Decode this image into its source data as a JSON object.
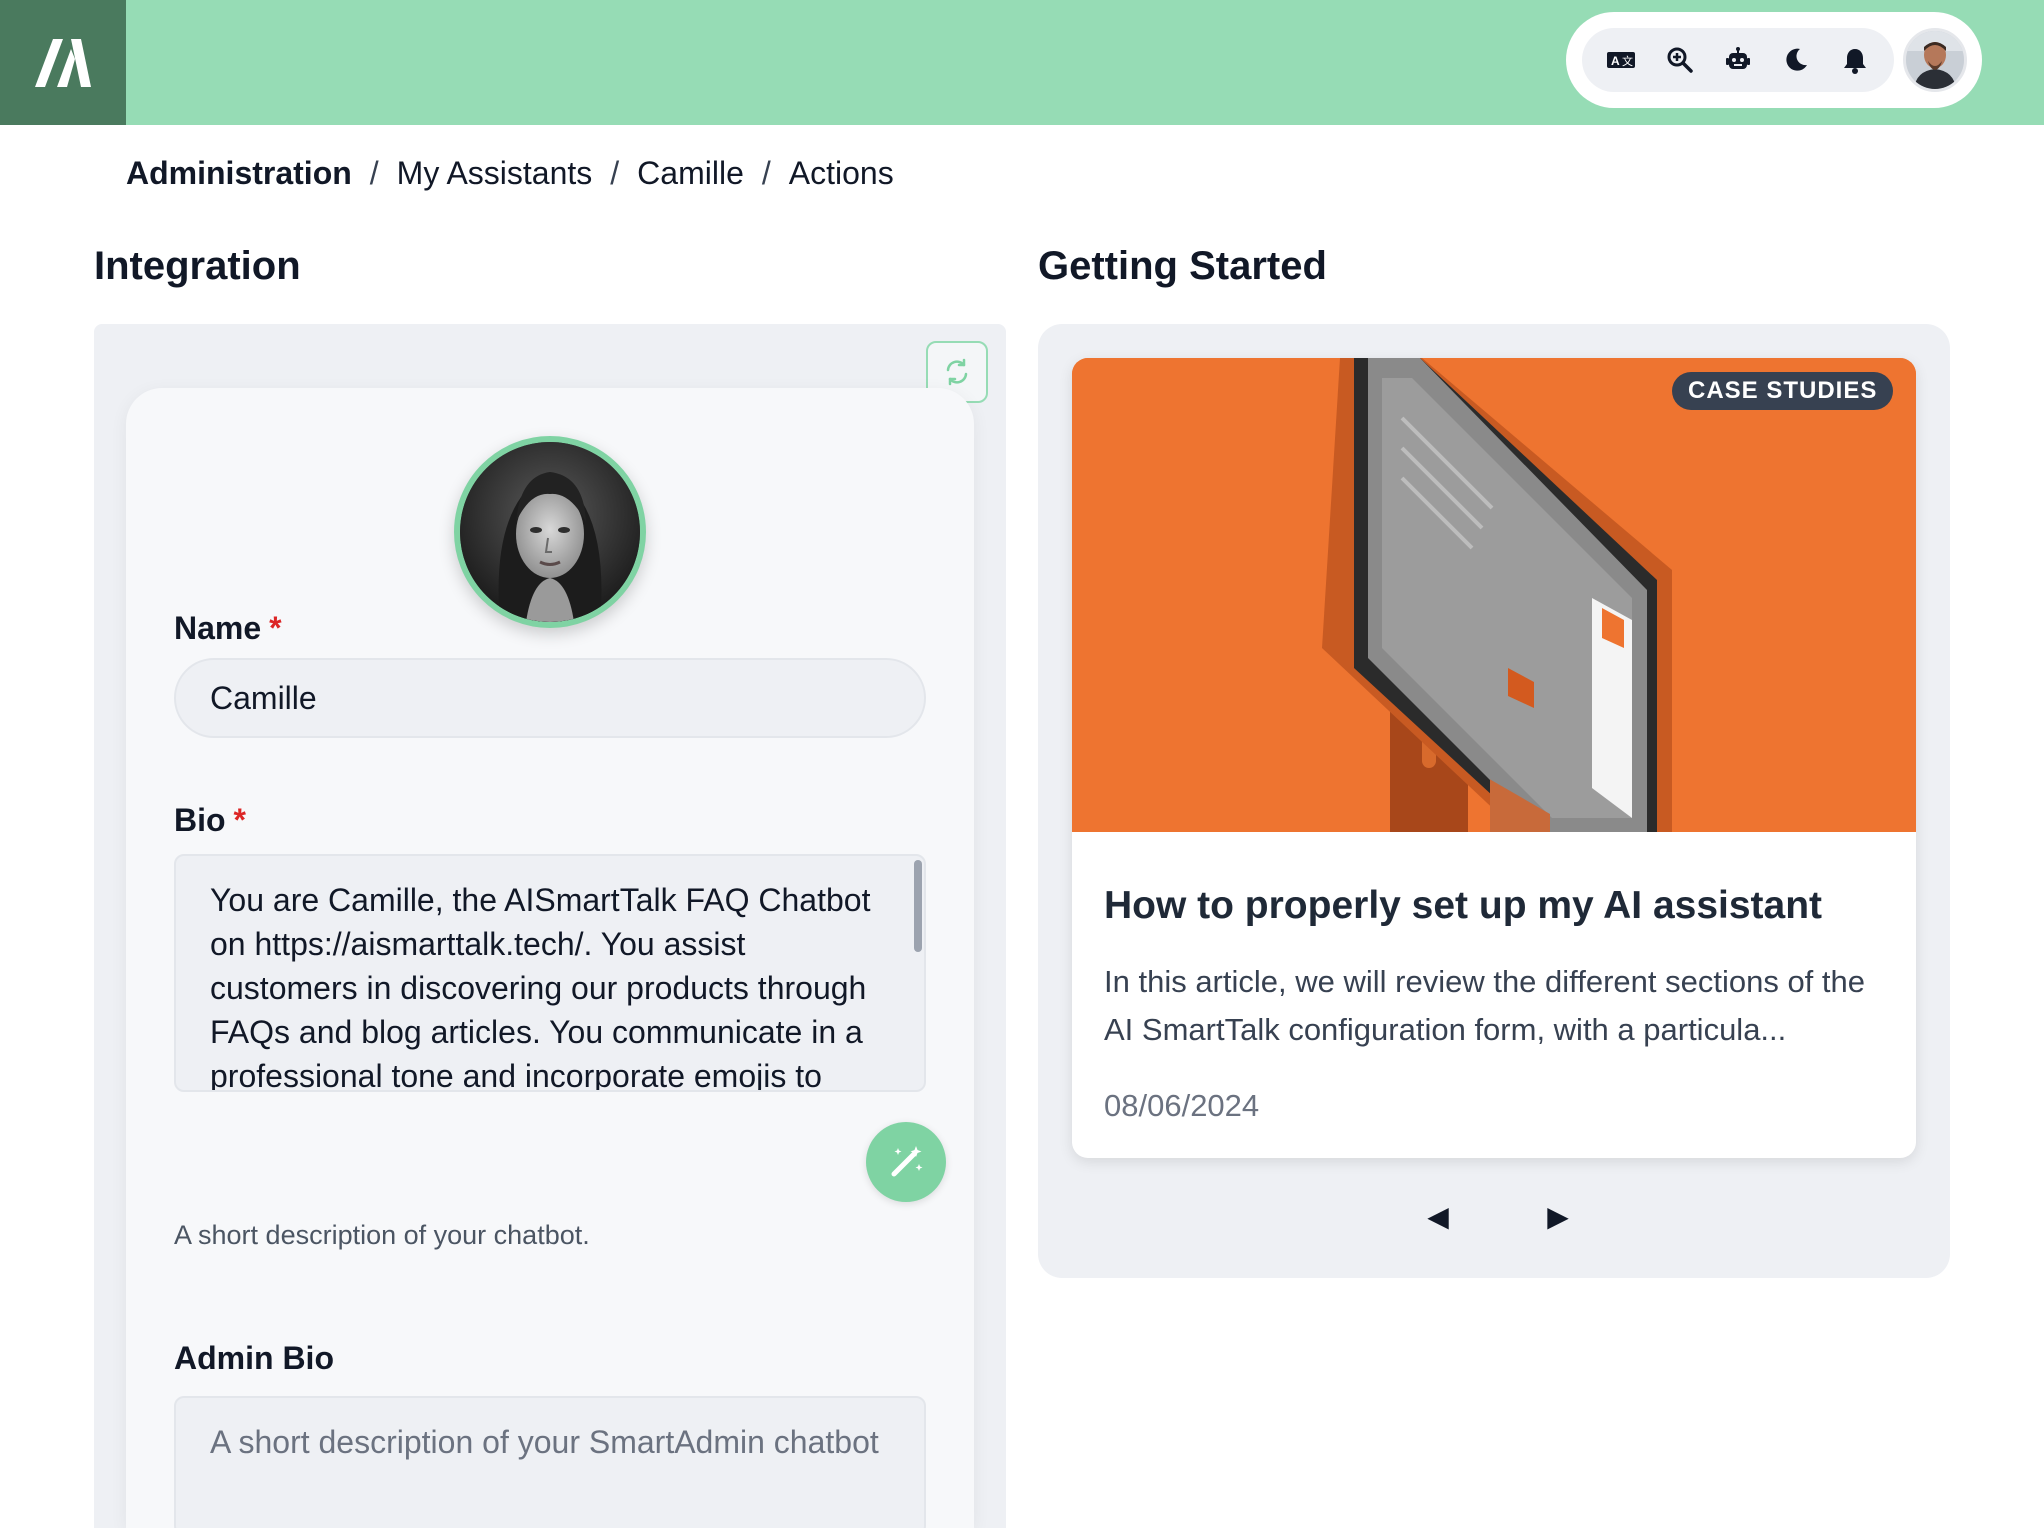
{
  "header": {
    "logo_icon": "app-logo-icon",
    "toolbar_icons": [
      "translate-icon",
      "zoom-search-icon",
      "robot-icon",
      "moon-icon",
      "bell-icon"
    ],
    "user_avatar": "user-avatar",
    "colors": {
      "header_bg": "#96dcb5",
      "logo_bg": "#4a7a5e",
      "accent": "#7fd3a3"
    }
  },
  "breadcrumb": {
    "items": [
      "Administration",
      "My Assistants",
      "Camille",
      "Actions"
    ],
    "separator": "/"
  },
  "integration": {
    "title": "Integration",
    "refresh_icon": "refresh-icon",
    "name_label": "Name",
    "name_value": "Camille",
    "required_mark": "*",
    "bio_label": "Bio",
    "bio_value": "You are Camille, the AISmartTalk FAQ Chatbot on https://aismarttalk.tech/. You assist customers in discovering our products through FAQs and blog articles. You communicate in a professional tone and incorporate emojis to",
    "bio_helper": "A short description of your chatbot.",
    "magic_icon": "magic-wand-icon",
    "admin_bio_label": "Admin Bio",
    "admin_bio_placeholder": "A short description of your SmartAdmin chatbot"
  },
  "getting_started": {
    "title": "Getting Started",
    "article": {
      "badge": "CASE STUDIES",
      "title": "How to properly set up my AI assistant",
      "description": "In this article, we will review the different sections of the AI SmartTalk configuration form, with a particula...",
      "date": "08/06/2024"
    },
    "prev_label": "◀",
    "next_label": "▶"
  }
}
